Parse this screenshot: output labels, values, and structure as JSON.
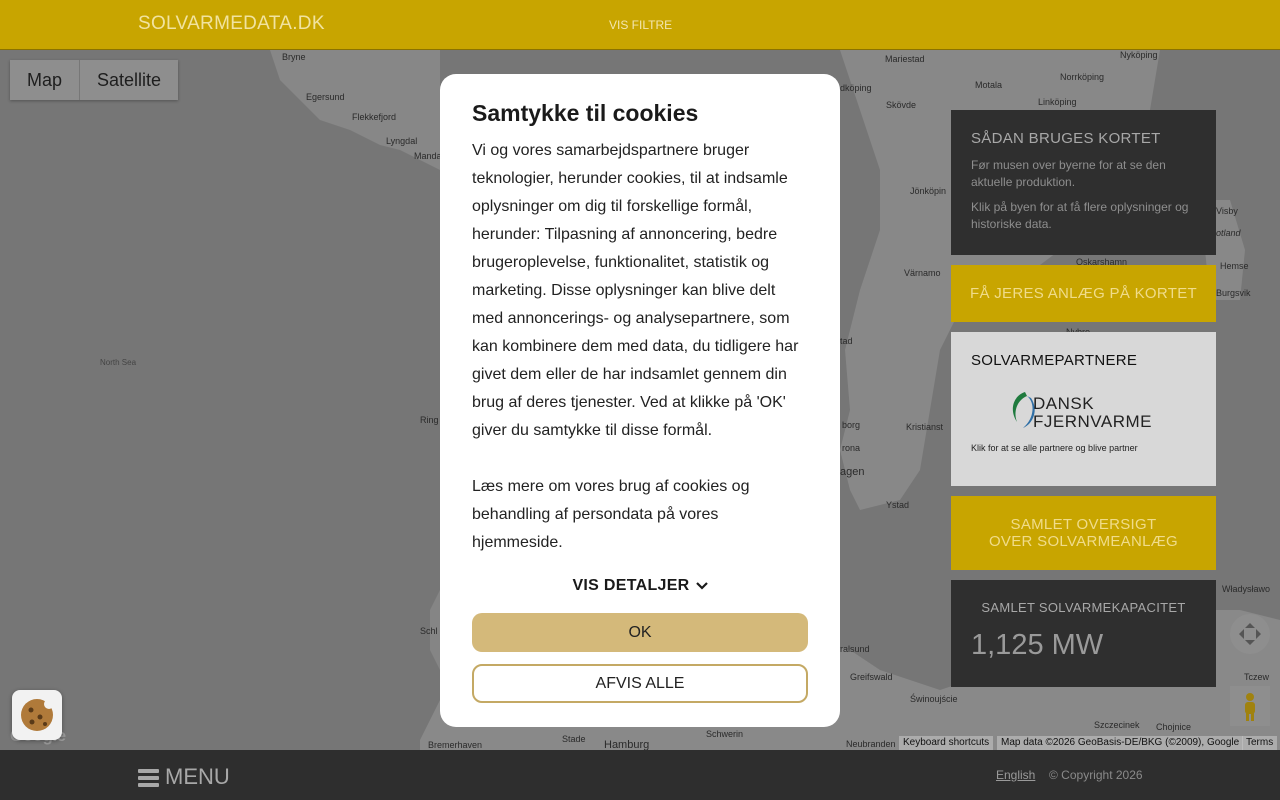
{
  "header": {
    "brand": "SOLVARMEDATA.DK",
    "filter_link": "VIS FILTRE"
  },
  "map": {
    "type_buttons": [
      "Map",
      "Satellite"
    ],
    "labels": {
      "bryne": "Bryne",
      "egersund": "Egersund",
      "flekkefjord": "Flekkefjord",
      "lyngdal": "Lyngdal",
      "mandal": "Manda",
      "north_sea": "North Sea",
      "ring": "Ring",
      "schl": "Schl",
      "bremerhaven": "Bremerhaven",
      "stade": "Stade",
      "hamburg": "Hamburg",
      "schwerin": "Schwerin",
      "neubranden": "Neubranden",
      "mariestad": "Mariestad",
      "motala": "Motala",
      "norrkoping": "Norrköping",
      "nykoping": "Nyköping",
      "linkoping": "Linköping",
      "skovde": "Skövde",
      "lidkoping": "dköping",
      "jonkoping": "Jönköpin",
      "varnamo": "Värnamo",
      "visby": "Visby",
      "gotland": "otland",
      "oskarshamn": "Oskarshamn",
      "hemse": "Hemse",
      "burgsvik": "Burgsvik",
      "tad": "tad",
      "borg": "borg",
      "kristianst": "Kristianst",
      "agen": "agen",
      "ystad": "Ystad",
      "greifswald": "Greifswald",
      "ralsund": "ralsund",
      "swinoujscie": "Świnoujście",
      "szczecinek": "Szczecinek",
      "chojnice": "Chojnice",
      "wladyslawo": "Władysławo",
      "tczew": "Tczew",
      "nybro": "Nybro",
      "falsterbo": "F",
      "rona": "rona"
    },
    "attribution": {
      "shortcuts": "Keyboard shortcuts",
      "data": "Map data ©2026 GeoBasis-DE/BKG (©2009), Google",
      "terms": "Terms"
    },
    "google_logo": "Google"
  },
  "panels": {
    "how_to": {
      "title": "SÅDAN BRUGES KORTET",
      "text1": "Før musen over byerne for at se den aktuelle produktion.",
      "text2": "Klik på byen for at få flere oplysninger og historiske data."
    },
    "get_plant": "FÅ JERES ANLÆG PÅ KORTET",
    "partners": {
      "title": "SOLVARMEPARTNERE",
      "logo_line1": "DANSK",
      "logo_line2": "FJERNVARME",
      "link": "Klik for at se alle partnere og blive partner"
    },
    "overview": {
      "line1": "SAMLET OVERSIGT",
      "line2": "OVER SOLVARMEANLÆG"
    },
    "capacity": {
      "title": "SAMLET SOLVARMEKAPACITET",
      "value": "1,125 MW"
    }
  },
  "footer": {
    "menu": "MENU",
    "language": "English",
    "copyright": "© Copyright 2026"
  },
  "cookie_modal": {
    "title": "Samtykke til cookies",
    "paragraph1": "Vi og vores samarbejdspartnere bruger teknologier, herunder cookies, til at indsamle oplysninger om dig til forskellige formål, herunder: Tilpasning af annoncering, bedre brugeroplevelse, funktionalitet, statistik og marketing. Disse oplysninger kan blive delt med annoncerings- og analysepartnere, som kan kombinere dem med data, du tidligere har givet dem eller de har indsamlet gennem din brug af deres tjenester. Ved at klikke på 'OK' giver du samtykke til disse formål.",
    "paragraph2": "Læs mere om vores brug af cookies og behandling af persondata på vores hjemmeside.",
    "details": "VIS DETALJER",
    "ok": "OK",
    "reject": "AFVIS ALLE"
  },
  "colors": {
    "brand_gold": "#c8a500",
    "dark_panel": "#2f2f2f",
    "ok_button": "#d4b97a"
  }
}
